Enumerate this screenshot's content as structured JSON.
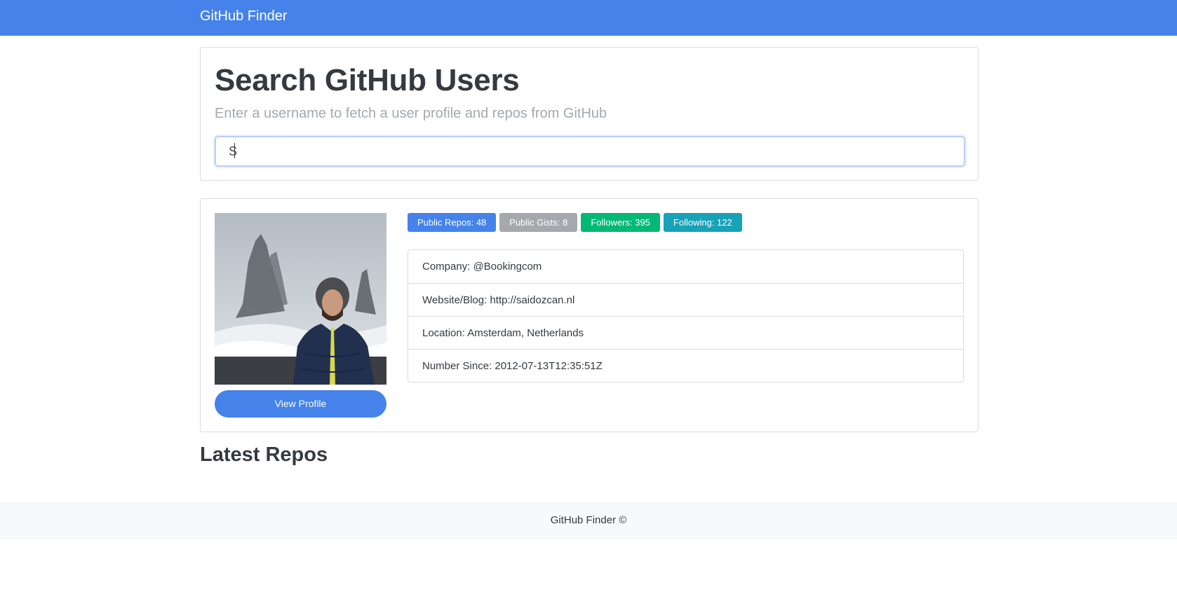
{
  "navbar": {
    "brand": "GitHub Finder"
  },
  "search": {
    "title": "Search GitHub Users",
    "lead": "Enter a username to fetch a user profile and repos from GitHub",
    "value": "S"
  },
  "profile": {
    "view_profile_label": "View Profile",
    "badges": [
      {
        "label": "Public Repos: 48",
        "color": "#4582ea"
      },
      {
        "label": "Public Gists: 8",
        "color": "#a4a9ae"
      },
      {
        "label": "Followers: 395",
        "color": "#02b875"
      },
      {
        "label": "Following: 122",
        "color": "#17a2b8"
      }
    ],
    "info": [
      "Company: @Bookingcom",
      "Website/Blog: http://saidozcan.nl",
      "Location: Amsterdam, Netherlands",
      "Number Since: 2012-07-13T12:35:51Z"
    ]
  },
  "repos": {
    "title": "Latest Repos"
  },
  "footer": {
    "text": "GitHub Finder ©"
  },
  "colors": {
    "primary": "#4582ea",
    "secondary": "#a4a9ae",
    "success": "#02b875",
    "info": "#17a2b8"
  }
}
